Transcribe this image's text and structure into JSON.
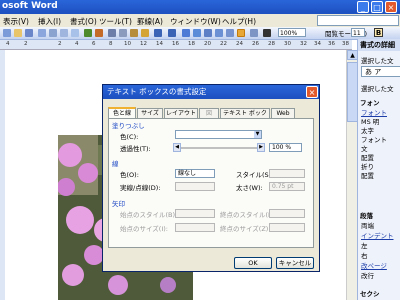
{
  "window": {
    "title": "osoft Word"
  },
  "menu": [
    "表示(V)",
    "挿入(I)",
    "書式(O)",
    "ツール(T)",
    "罫線(A)",
    "ウィンドウ(W)",
    "ヘルプ(H)"
  ],
  "toolbar": {
    "zoom": "100%",
    "reading_mode": "閲覧モード(R)",
    "font_size": "11",
    "bold": "B"
  },
  "ruler": {
    "numbers": [
      "4",
      "2",
      "2",
      "4",
      "6",
      "8",
      "10",
      "12",
      "14",
      "16",
      "18",
      "20",
      "22",
      "24",
      "26",
      "28",
      "30",
      "32",
      "34",
      "36",
      "38"
    ]
  },
  "task_pane": {
    "title": "書式の詳細",
    "selected1": "選択した文",
    "preview": "あ ア",
    "selected2": "選択した文",
    "font_head": "フォン",
    "font_link": "フォント",
    "font_vals": [
      "MS 明",
      "太字",
      "フォント"
    ],
    "label1": "文",
    "wrap_head": "配置",
    "wrap_vals": [
      "折り",
      "配置"
    ],
    "para_head": "段落",
    "para_vals": [
      "両端",
      "インデント",
      "左",
      "右",
      "改ページ",
      "改行",
      "セクシ"
    ]
  },
  "dialog": {
    "title": "テキスト ボックスの書式設定",
    "tabs": [
      "色と線",
      "サイズ",
      "レイアウト",
      "図",
      "テキスト ボックス",
      "Web"
    ],
    "fill": {
      "section": "塗りつぶし",
      "color_label": "色(C):",
      "transparency_label": "透過性(T):",
      "transparency_value": "100 %"
    },
    "line": {
      "section": "線",
      "color_label": "色(O):",
      "color_value": "線なし",
      "style_label": "スタイル(S):",
      "dash_label": "実線/点線(D):",
      "weight_label": "太さ(W):",
      "weight_value": "0.75 pt"
    },
    "arrows": {
      "section": "矢印",
      "begin_style": "始点のスタイル(B):",
      "end_style": "終点のスタイル(E):",
      "begin_size": "始点のサイズ(I):",
      "end_size": "終点のサイズ(Z):"
    },
    "ok": "OK",
    "cancel": "キャンセル"
  }
}
